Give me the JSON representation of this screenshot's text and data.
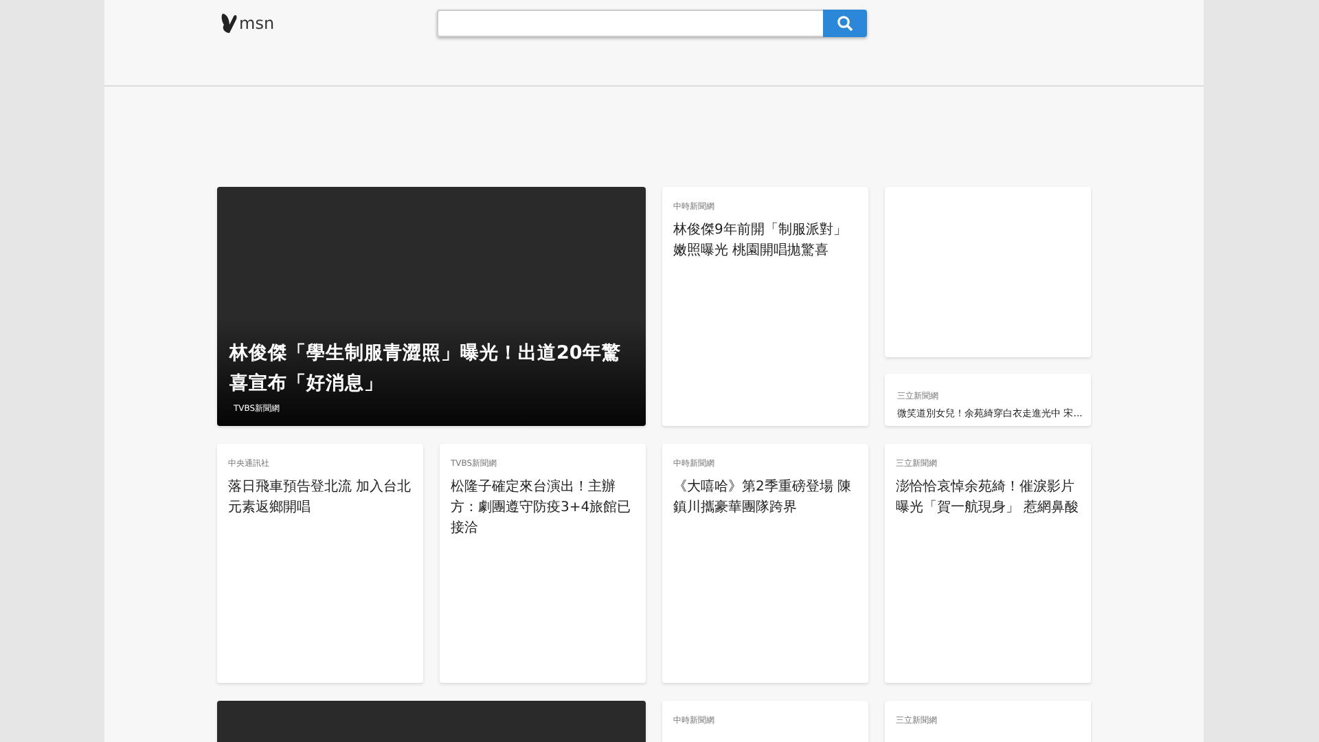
{
  "header": {
    "logo": "msn"
  },
  "cards": [
    {
      "kind": "feature",
      "source": "TVBS新聞網",
      "title": "林俊傑「學生制服青澀照」曝光！出道20年驚喜宣布「好消息」"
    },
    {
      "kind": "text",
      "source": "中時新聞網",
      "title": "林俊傑9年前開「制服派對」嫩照曝光 桃園開唱拋驚喜"
    },
    {
      "kind": "stack",
      "items": [
        {
          "kind": "blank"
        },
        {
          "kind": "small",
          "source": "三立新聞網",
          "title": "微笑道別女兒！余苑綺穿白衣走進光中 宋..."
        }
      ]
    },
    {
      "kind": "text",
      "source": "中央通訊社",
      "title": "落日飛車預告登北流 加入台北元素返鄉開唱"
    },
    {
      "kind": "text",
      "source": "TVBS新聞網",
      "title": "松隆子確定來台演出！主辦方：劇團遵守防疫3+4旅館已接洽"
    },
    {
      "kind": "text",
      "source": "中時新聞網",
      "title": "《大嘻哈》第2季重磅登場 陳鎮川攜豪華團隊跨界"
    },
    {
      "kind": "text",
      "source": "三立新聞網",
      "title": "澎恰恰哀悼余苑綺！催淚影片曝光「賀一航現身」 惹網鼻酸"
    },
    {
      "kind": "feature"
    },
    {
      "kind": "text",
      "source": "中時新聞網"
    },
    {
      "kind": "text",
      "source": "三立新聞網"
    }
  ]
}
